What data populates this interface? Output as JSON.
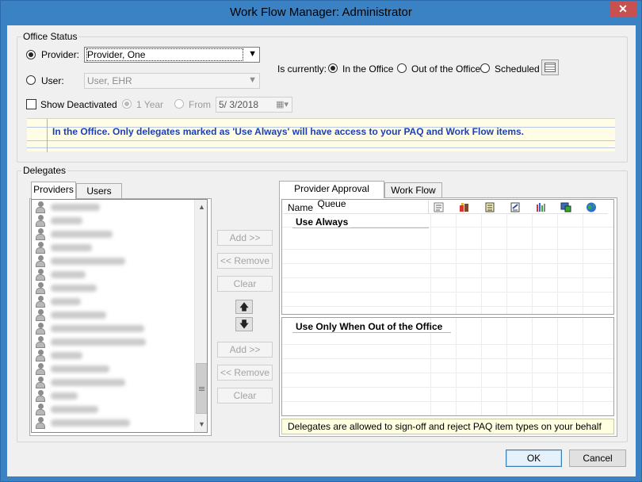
{
  "window": {
    "title": "Work Flow Manager: Administrator",
    "close_glyph": "✕"
  },
  "office_status": {
    "group_label": "Office Status",
    "provider_label": "Provider:",
    "provider_value": "Provider, One",
    "user_label": "User:",
    "user_value": "User, EHR",
    "is_currently_label": "Is currently:",
    "status_options": [
      "In the Office",
      "Out of the Office",
      "Scheduled"
    ],
    "status_selected": "In the Office",
    "show_deactivated_label": "Show Deactivated",
    "one_year_label": "1 Year",
    "from_label": "From",
    "from_date": "5/  3/2018",
    "status_message": "In the Office.  Only delegates marked as 'Use Always' will have access to your PAQ and Work Flow items."
  },
  "delegates": {
    "group_label": "Delegates",
    "left_tabs": [
      "Providers",
      "Users"
    ],
    "active_left_tab": "Providers",
    "list_icon": "person-icon",
    "list_row_count": 17,
    "buttons_top": {
      "add": "Add >>",
      "remove": "<< Remove",
      "clear": "Clear"
    },
    "buttons_bottom": {
      "add": "Add >>",
      "remove": "<< Remove",
      "clear": "Clear"
    },
    "move_up_glyph": "🡅",
    "move_down_glyph": "🡇",
    "right_tabs": [
      "Provider Approval Queue",
      "Work Flow"
    ],
    "active_right_tab": "Provider Approval Queue",
    "grid_header_name": "Name",
    "grid_header_icons": [
      "note-icon",
      "lab-icon",
      "document-icon",
      "form-icon",
      "chart-icon",
      "image-icon",
      "globe-icon"
    ],
    "use_always_title": "Use Always",
    "out_of_office_title": "Use Only When Out of the Office",
    "info_message": "Delegates are allowed to sign-off and reject PAQ item types on your behalf"
  },
  "footer": {
    "ok_label": "OK",
    "cancel_label": "Cancel"
  },
  "colors": {
    "title_bar": "#3b82c4",
    "banner_text": "#1c3fb5",
    "banner_bg": "#fffde6",
    "close_button": "#c75050"
  }
}
